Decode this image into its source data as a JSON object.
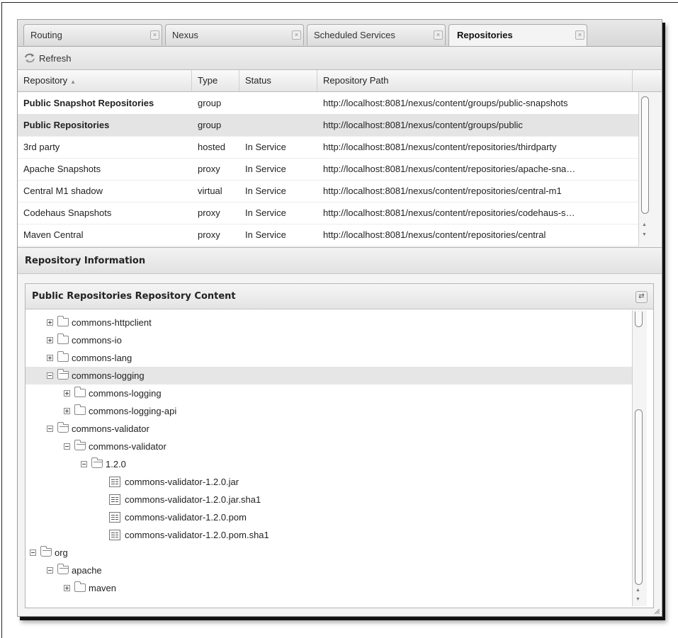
{
  "tabs": [
    {
      "label": "Routing",
      "active": false
    },
    {
      "label": "Nexus",
      "active": false
    },
    {
      "label": "Scheduled Services",
      "active": false
    },
    {
      "label": "Repositories",
      "active": true
    }
  ],
  "toolbar": {
    "refresh_label": "Refresh",
    "refresh_icon": "refresh-icon"
  },
  "grid": {
    "columns": [
      "Repository",
      "Type",
      "Status",
      "Repository Path"
    ],
    "sort_indicator": "▲",
    "rows": [
      {
        "name": "Public Snapshot Repositories",
        "type": "group",
        "status": "",
        "path": "http://localhost:8081/nexus/content/groups/public-snapshots",
        "bold": true,
        "selected": false
      },
      {
        "name": "Public Repositories",
        "type": "group",
        "status": "",
        "path": "http://localhost:8081/nexus/content/groups/public",
        "bold": true,
        "selected": true
      },
      {
        "name": "3rd party",
        "type": "hosted",
        "status": "In Service",
        "path": "http://localhost:8081/nexus/content/repositories/thirdparty",
        "bold": false,
        "selected": false
      },
      {
        "name": "Apache Snapshots",
        "type": "proxy",
        "status": "In Service",
        "path": "http://localhost:8081/nexus/content/repositories/apache-sna…",
        "bold": false,
        "selected": false
      },
      {
        "name": "Central M1 shadow",
        "type": "virtual",
        "status": "In Service",
        "path": "http://localhost:8081/nexus/content/repositories/central-m1",
        "bold": false,
        "selected": false
      },
      {
        "name": "Codehaus Snapshots",
        "type": "proxy",
        "status": "In Service",
        "path": "http://localhost:8081/nexus/content/repositories/codehaus-s…",
        "bold": false,
        "selected": false
      },
      {
        "name": "Maven Central",
        "type": "proxy",
        "status": "In Service",
        "path": "http://localhost:8081/nexus/content/repositories/central",
        "bold": false,
        "selected": false
      }
    ]
  },
  "info_panel": {
    "title": "Repository Information"
  },
  "content_panel": {
    "title": "Public Repositories Repository Content",
    "tree": [
      {
        "label": "commons-httpclient",
        "depth": 1,
        "kind": "folder",
        "expanded": false
      },
      {
        "label": "commons-io",
        "depth": 1,
        "kind": "folder",
        "expanded": false
      },
      {
        "label": "commons-lang",
        "depth": 1,
        "kind": "folder",
        "expanded": false
      },
      {
        "label": "commons-logging",
        "depth": 1,
        "kind": "folder",
        "expanded": true,
        "selected": true
      },
      {
        "label": "commons-logging",
        "depth": 2,
        "kind": "folder",
        "expanded": false
      },
      {
        "label": "commons-logging-api",
        "depth": 2,
        "kind": "folder",
        "expanded": false
      },
      {
        "label": "commons-validator",
        "depth": 1,
        "kind": "folder",
        "expanded": true
      },
      {
        "label": "commons-validator",
        "depth": 2,
        "kind": "folder",
        "expanded": true
      },
      {
        "label": "1.2.0",
        "depth": 3,
        "kind": "folder",
        "expanded": true
      },
      {
        "label": "commons-validator-1.2.0.jar",
        "depth": 4,
        "kind": "file"
      },
      {
        "label": "commons-validator-1.2.0.jar.sha1",
        "depth": 4,
        "kind": "file"
      },
      {
        "label": "commons-validator-1.2.0.pom",
        "depth": 4,
        "kind": "file"
      },
      {
        "label": "commons-validator-1.2.0.pom.sha1",
        "depth": 4,
        "kind": "file"
      },
      {
        "label": "org",
        "depth": 0,
        "kind": "folder",
        "expanded": true
      },
      {
        "label": "apache",
        "depth": 1,
        "kind": "folder",
        "expanded": true
      },
      {
        "label": "maven",
        "depth": 2,
        "kind": "folder",
        "expanded": false
      }
    ]
  }
}
